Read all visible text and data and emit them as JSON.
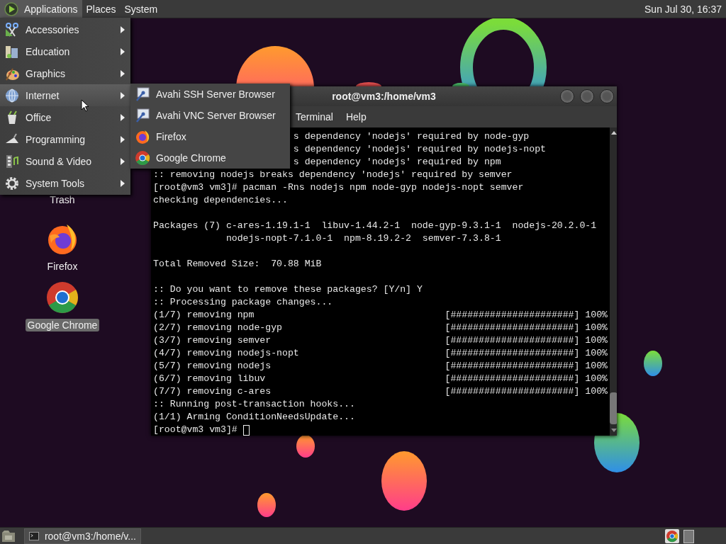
{
  "top_panel": {
    "menus": [
      {
        "label": "Applications",
        "selected": true
      },
      {
        "label": "Places",
        "selected": false
      },
      {
        "label": "System",
        "selected": false
      }
    ],
    "clock": "Sun Jul 30, 16:37"
  },
  "applications_menu": {
    "items": [
      {
        "label": "Accessories",
        "selected": false
      },
      {
        "label": "Education",
        "selected": false
      },
      {
        "label": "Graphics",
        "selected": false
      },
      {
        "label": "Internet",
        "selected": true
      },
      {
        "label": "Office",
        "selected": false
      },
      {
        "label": "Programming",
        "selected": false
      },
      {
        "label": "Sound & Video",
        "selected": false
      },
      {
        "label": "System Tools",
        "selected": false
      }
    ]
  },
  "internet_submenu": {
    "items": [
      {
        "label": "Avahi SSH Server Browser"
      },
      {
        "label": "Avahi VNC Server Browser"
      },
      {
        "label": "Firefox"
      },
      {
        "label": "Google Chrome"
      }
    ]
  },
  "terminal_window": {
    "title": "root@vm3:/home/vm3",
    "menus": [
      "Terminal",
      "Help"
    ],
    "lines": [
      {
        "kind": "partial",
        "text": "s dependency 'nodejs' required by node-gyp"
      },
      {
        "kind": "partial",
        "text": "s dependency 'nodejs' required by nodejs-nopt"
      },
      {
        "kind": "partial",
        "text": "s dependency 'nodejs' required by npm"
      },
      {
        "kind": "output",
        "text": ":: removing nodejs breaks dependency 'nodejs' required by semver"
      },
      {
        "kind": "output",
        "text": "[root@vm3 vm3]# pacman -Rns nodejs npm node-gyp nodejs-nopt semver"
      },
      {
        "kind": "output",
        "text": "checking dependencies..."
      },
      {
        "kind": "blank"
      },
      {
        "kind": "output",
        "text": "Packages (7) c-ares-1.19.1-1  libuv-1.44.2-1  node-gyp-9.3.1-1  nodejs-20.2.0-1"
      },
      {
        "kind": "continuation",
        "text": "nodejs-nopt-7.1.0-1  npm-8.19.2-2  semver-7.3.8-1"
      },
      {
        "kind": "blank"
      },
      {
        "kind": "output",
        "text": "Total Removed Size:  70.88 MiB"
      },
      {
        "kind": "blank"
      },
      {
        "kind": "output",
        "text": ":: Do you want to remove these packages? [Y/n] Y"
      },
      {
        "kind": "output",
        "text": ":: Processing package changes..."
      },
      {
        "kind": "progress",
        "text": "(1/7) removing npm",
        "bar": "[######################] 100%"
      },
      {
        "kind": "progress",
        "text": "(2/7) removing node-gyp",
        "bar": "[######################] 100%"
      },
      {
        "kind": "progress",
        "text": "(3/7) removing semver",
        "bar": "[######################] 100%"
      },
      {
        "kind": "progress",
        "text": "(4/7) removing nodejs-nopt",
        "bar": "[######################] 100%"
      },
      {
        "kind": "progress",
        "text": "(5/7) removing nodejs",
        "bar": "[######################] 100%"
      },
      {
        "kind": "progress",
        "text": "(6/7) removing libuv",
        "bar": "[######################] 100%"
      },
      {
        "kind": "progress",
        "text": "(7/7) removing c-ares",
        "bar": "[######################] 100%"
      },
      {
        "kind": "output",
        "text": ":: Running post-transaction hooks..."
      },
      {
        "kind": "output",
        "text": "(1/1) Arming ConditionNeedsUpdate..."
      },
      {
        "kind": "prompt",
        "text": "[root@vm3 vm3]#"
      }
    ]
  },
  "desktop_icons": [
    {
      "label": "Trash",
      "selected": false
    },
    {
      "label": "Firefox",
      "selected": false
    },
    {
      "label": "Google Chrome",
      "selected": true
    }
  ],
  "bottom_panel": {
    "tasks": [
      {
        "label": "root@vm3:/home/v..."
      }
    ]
  }
}
